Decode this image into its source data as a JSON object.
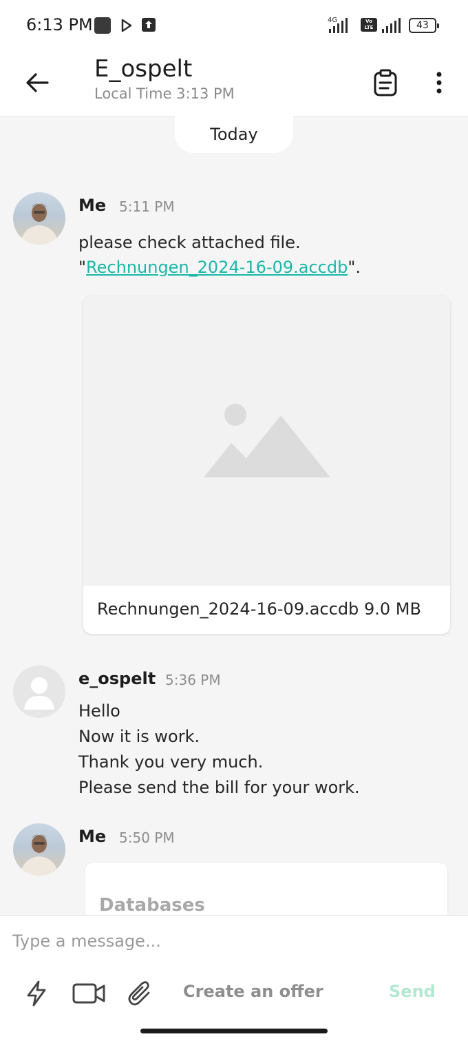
{
  "status_bar": {
    "time": "6:13 PM",
    "network_label": "4G",
    "volte_label": "Vo LTE",
    "battery": "43"
  },
  "header": {
    "contact_name": "E_ospelt",
    "local_time": "Local Time 3:13 PM"
  },
  "date_divider": "Today",
  "messages": [
    {
      "sender": "Me",
      "time": "5:11 PM",
      "line1": "please check attached file.",
      "quote_open": "\"",
      "file_link": "Rechnungen_2024-16-09.accdb",
      "quote_close": "\".",
      "attachment": {
        "file_name": "Rechnungen_2024-16-09.accdb",
        "file_size": "9.0 MB"
      }
    },
    {
      "sender": "e_ospelt",
      "time": "5:36 PM",
      "lines": [
        "Hello",
        "Now it is work.",
        "Thank you very much.",
        "Please send the bill for your work."
      ]
    },
    {
      "sender": "Me",
      "time": "5:50 PM",
      "card_label": "Databases"
    }
  ],
  "composer": {
    "placeholder": "Type a message...",
    "offer_label": "Create an offer",
    "send_label": "Send"
  },
  "colors": {
    "link": "#19b8a8",
    "send_disabled": "#b3e8d2",
    "background": "#f5f5f5"
  },
  "icons": [
    "back-arrow-icon",
    "clipboard-icon",
    "more-vertical-icon",
    "image-placeholder-icon",
    "person-icon",
    "lightning-icon",
    "video-camera-icon",
    "paperclip-icon"
  ]
}
